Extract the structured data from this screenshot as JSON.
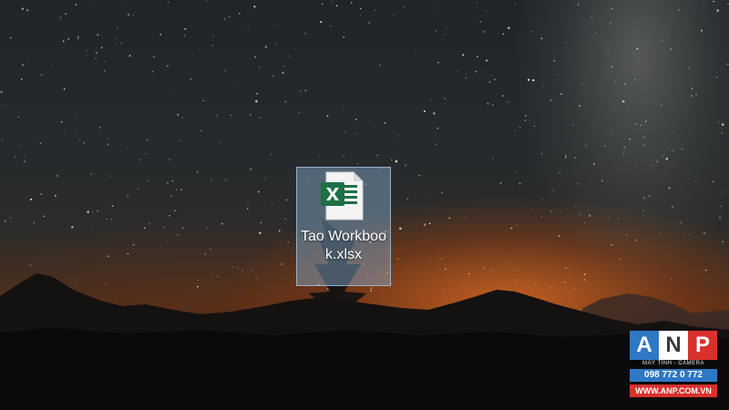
{
  "desktop": {
    "file_icon": {
      "name": "Tao Workbook.xlsx",
      "icon": "excel-file-icon",
      "brand_color": "#1d7044",
      "selected": true
    }
  },
  "watermark": {
    "letters": [
      "A",
      "N",
      "P"
    ],
    "tagline": "MÁY TÍNH - CAMERA",
    "phone": "098 772 0 772",
    "website": "WWW.ANP.COM.VN",
    "colors": {
      "blue": "#2f78c4",
      "red": "#d8312c"
    }
  }
}
